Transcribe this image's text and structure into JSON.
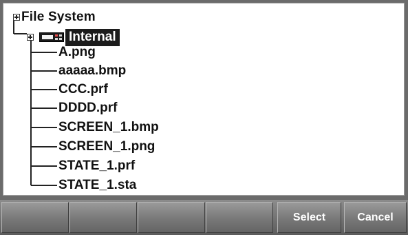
{
  "tree": {
    "root": {
      "label": "File System",
      "expander_icon": "minus-box-icon"
    },
    "internal": {
      "label": "Internal",
      "expander_icon": "minus-box-icon",
      "device_icon": "instrument-icon",
      "selected": true
    },
    "files": [
      {
        "label": "A.png"
      },
      {
        "label": "aaaaa.bmp"
      },
      {
        "label": "CCC.prf"
      },
      {
        "label": "DDDD.prf"
      },
      {
        "label": "SCREEN_1.bmp"
      },
      {
        "label": "SCREEN_1.png"
      },
      {
        "label": "STATE_1.prf"
      },
      {
        "label": "STATE_1.sta"
      }
    ]
  },
  "softkeys": [
    {
      "label": ""
    },
    {
      "label": ""
    },
    {
      "label": ""
    },
    {
      "label": ""
    },
    {
      "label": "Select"
    },
    {
      "label": "Cancel"
    }
  ],
  "colors": {
    "selection_background": "#1c1c1c",
    "selection_text": "#ffffff",
    "panel_background": "#ffffff",
    "softkey_background": "#787878"
  }
}
